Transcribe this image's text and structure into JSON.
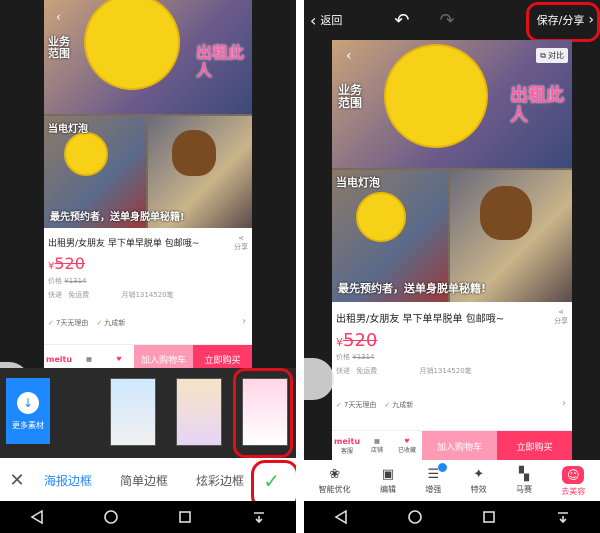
{
  "product": {
    "photo_texts": {
      "service_scope": "业务范围",
      "light_bulb": "当电灯泡",
      "for_rent": "出租此人",
      "first_book": "最先预约者，送单身脱单秘籍!"
    },
    "title": "出租男/女朋友 早下单早脱单 包邮哦~",
    "currency": "¥",
    "price": "520",
    "original_price_label": "价格",
    "original_price": "¥1314",
    "delivery_label": "快递",
    "delivery_value": "免运费",
    "monthly_sales": "月销1314520笔",
    "share_label": "分享",
    "promo1": "7天无理由",
    "promo2": "九成新",
    "shop_logo": "meitu",
    "service_label": "客服",
    "store_label": "店铺",
    "favorite_label": "已收藏",
    "add_cart_label": "加入购物车",
    "buy_now_label": "立即购买"
  },
  "left_editor": {
    "more_materials_label": "更多素材",
    "tabs": [
      "海报边框",
      "简单边框",
      "炫彩边框"
    ],
    "active_tab_index": 0
  },
  "right_editor": {
    "back_label": "返回",
    "save_share_label": "保存/分享",
    "compare_label": "对比",
    "tools": [
      "智能优化",
      "编辑",
      "增强",
      "特效",
      "马赛",
      "去美容"
    ],
    "active_tool": "去美容",
    "badge_tool_index": 2
  },
  "colors": {
    "accent_pink": "#ff3a67",
    "active_tab_blue": "#1e88ff",
    "confirm_green": "#3cc84a",
    "highlight_red": "#e0101a"
  }
}
